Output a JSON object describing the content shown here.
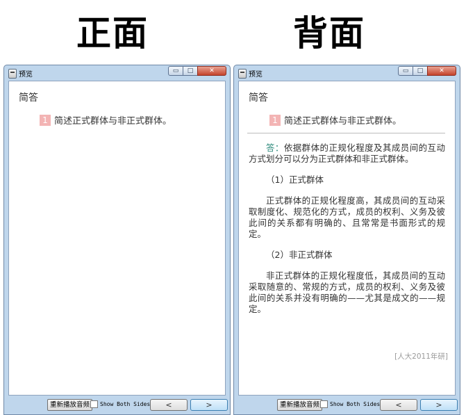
{
  "labels": {
    "front": "正面",
    "back": "背面"
  },
  "window": {
    "title": "预览",
    "min_glyph": "▭",
    "max_glyph": "□",
    "close_glyph": "✕"
  },
  "card": {
    "section": "简答",
    "question_number": "1",
    "question": "简述正式群体与非正式群体。",
    "answer_label": "答：",
    "answer_intro": "依据群体的正规化程度及其成员间的互动方式划分可以分为正式群体和非正式群体。",
    "heading1": "（1）正式群体",
    "para1": "正式群体的正规化程度高，其成员间的互动采取制度化、规范化的方式，成员的权利、义务及彼此间的关系都有明确的、且常常是书面形式的规定。",
    "heading2": "（2）非正式群体",
    "para2": "非正式群体的正规化程度低，其成员间的互动采取随意的、常规的方式，成员的权利、义务及彼此间的关系并没有明确的——尤其是成文的——规定。",
    "source": "[人大2011年研]"
  },
  "bottom": {
    "replay_label": "重新播放音频",
    "show_both_label": "Show Both Sides",
    "prev_glyph": "<",
    "next_glyph": ">"
  }
}
